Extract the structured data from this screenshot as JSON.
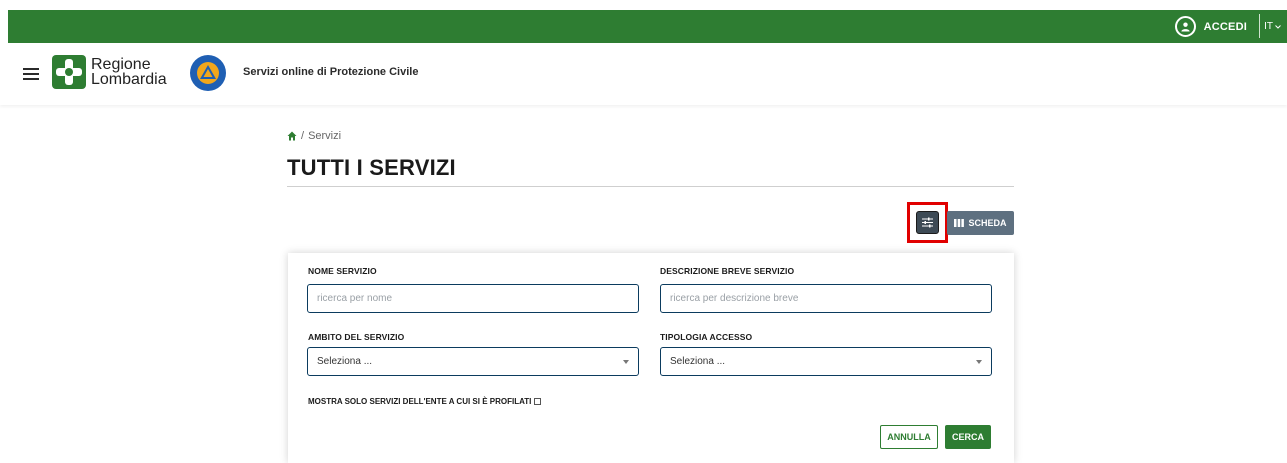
{
  "topbar": {
    "login_label": "ACCEDI",
    "language": "IT",
    "icons": {
      "user": "user-circle-icon",
      "lang_caret": "chevron-down-icon"
    },
    "bg_color": "#2e7d32"
  },
  "header": {
    "logo_line1": "Regione",
    "logo_line2": "Lombardia",
    "site_title": "Servizi online di Protezione Civile",
    "icons": {
      "menu": "hamburger-menu-icon",
      "logo": "regione-lombardia-logo",
      "emblem": "protezione-civile-emblem"
    }
  },
  "breadcrumb": {
    "home_icon": "home-icon",
    "separator": "/",
    "current": "Servizi"
  },
  "page": {
    "title": "TUTTI I SERVIZI"
  },
  "view_controls": {
    "filter_icon": "sliders-icon",
    "scheda_icon": "grid-columns-icon",
    "scheda_label": "SCHEDA"
  },
  "filters": {
    "nome": {
      "label": "NOME SERVIZIO",
      "placeholder": "ricerca per nome",
      "value": ""
    },
    "descrizione": {
      "label": "DESCRIZIONE BREVE SERVIZIO",
      "placeholder": "ricerca per descrizione breve",
      "value": ""
    },
    "ambito": {
      "label": "AMBITO DEL SERVIZIO",
      "selected": "Seleziona ..."
    },
    "tipologia": {
      "label": "TIPOLOGIA ACCESSO",
      "selected": "Seleziona ..."
    },
    "checkbox_label": "MOSTRA SOLO SERVIZI DELL'ENTE A CUI SI È PROFILATI",
    "checkbox_checked": false,
    "cancel_label": "ANNULLA",
    "search_label": "CERCA"
  }
}
